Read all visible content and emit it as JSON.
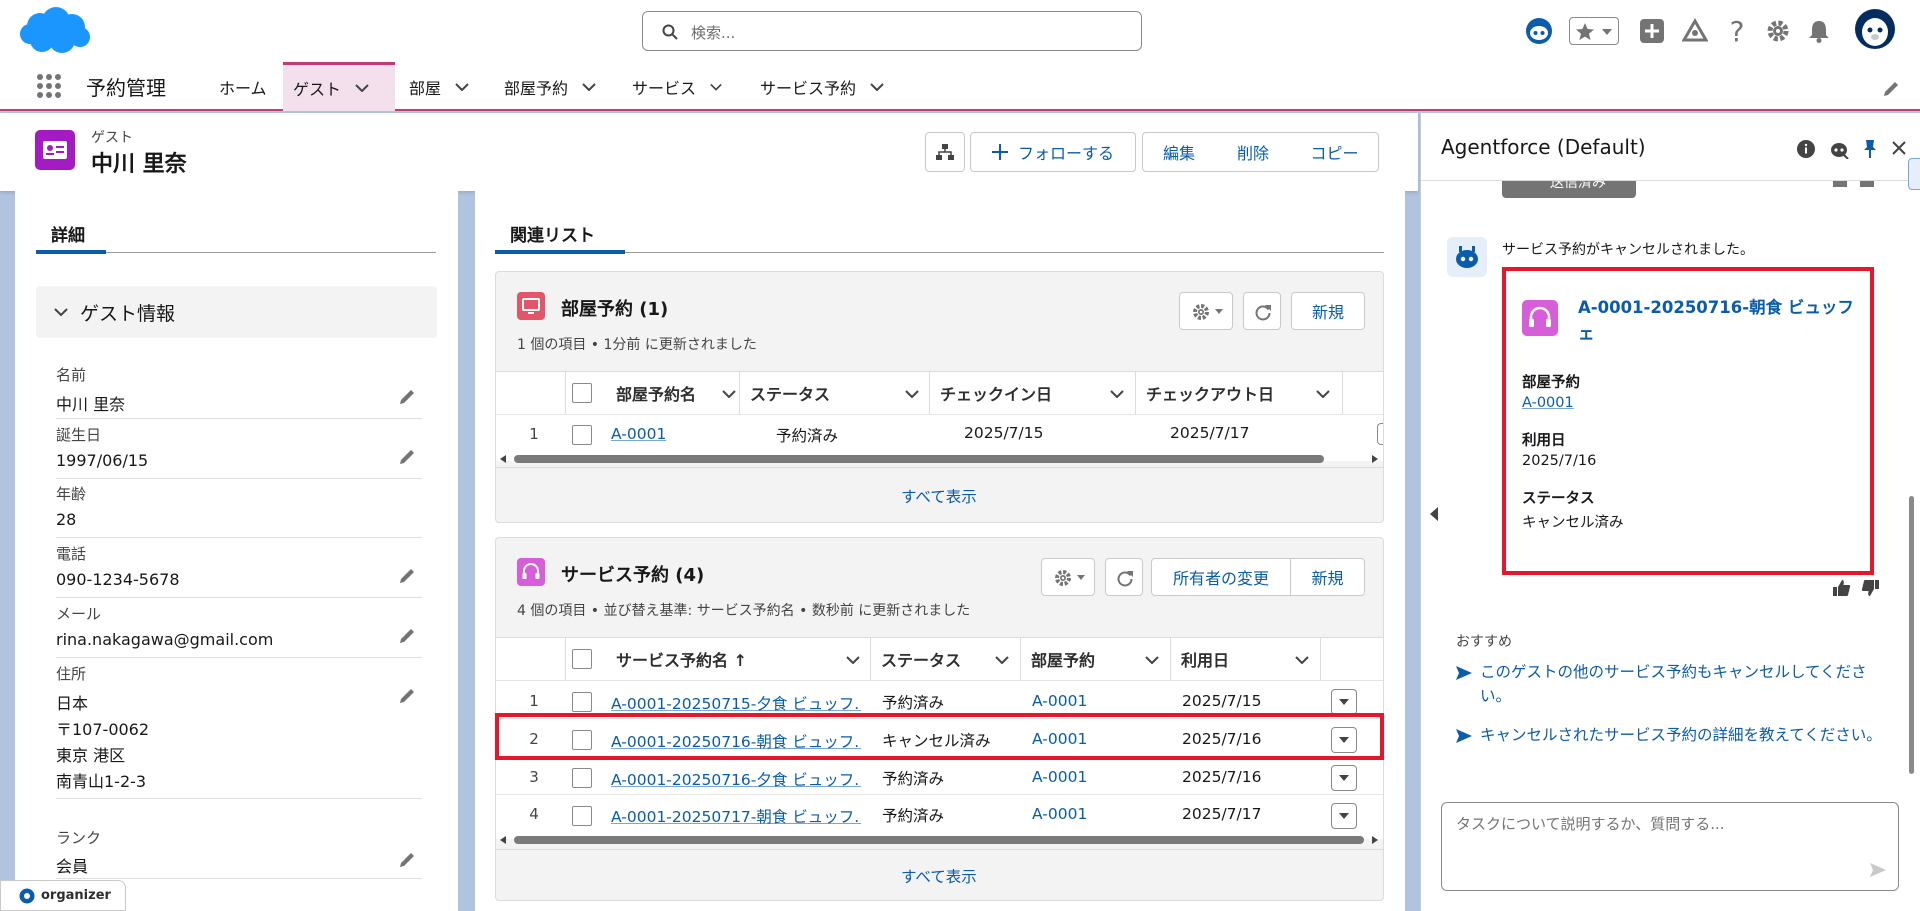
{
  "header": {
    "search_placeholder": "検索...",
    "app_name": "予約管理",
    "nav_tabs": [
      {
        "label": "ホーム"
      },
      {
        "label": "ゲスト"
      },
      {
        "label": "部屋"
      },
      {
        "label": "部屋予約"
      },
      {
        "label": "サービス"
      },
      {
        "label": "サービス予約"
      }
    ]
  },
  "record": {
    "object_label": "ゲスト",
    "name": "中川 里奈",
    "buttons": {
      "follow": "フォローする",
      "edit": "編集",
      "delete": "削除",
      "copy": "コピー"
    }
  },
  "details": {
    "tab": "詳細",
    "section": "ゲスト情報",
    "fields": {
      "name": {
        "label": "名前",
        "value": "中川 里奈"
      },
      "birthday": {
        "label": "誕生日",
        "value": "1997/06/15"
      },
      "age": {
        "label": "年齢",
        "value": "28"
      },
      "phone": {
        "label": "電話",
        "value": "090-1234-5678"
      },
      "email": {
        "label": "メール",
        "value": "rina.nakagawa@gmail.com"
      },
      "address": {
        "label": "住所",
        "lines": [
          "日本",
          "〒107-0062",
          "東京 港区",
          "南青山1-2-3"
        ]
      },
      "rank": {
        "label": "ランク",
        "value": "会員"
      }
    },
    "organizer_badge": "organizer"
  },
  "related": {
    "tab": "関連リスト",
    "room_reservations": {
      "title": "部屋予約 (1)",
      "subtitle": "1 個の項目 • 1分前 に更新されました",
      "new_label": "新規",
      "columns": [
        "部屋予約名",
        "ステータス",
        "チェックイン日",
        "チェックアウト日"
      ],
      "rows": [
        {
          "num": "1",
          "name": "A-0001",
          "status": "予約済み",
          "checkin": "2025/7/15",
          "checkout": "2025/7/17"
        }
      ],
      "view_all": "すべて表示"
    },
    "service_reservations": {
      "title": "サービス予約 (4)",
      "subtitle": "4 個の項目 • 並び替え基準: サービス予約名 • 数秒前 に更新されました",
      "change_owner_label": "所有者の変更",
      "new_label": "新規",
      "columns": [
        "サービス予約名 ↑",
        "ステータス",
        "部屋予約",
        "利用日"
      ],
      "rows": [
        {
          "num": "1",
          "name": "A-0001-20250715-夕食 ビュッフ...",
          "status": "予約済み",
          "room": "A-0001",
          "date": "2025/7/15"
        },
        {
          "num": "2",
          "name": "A-0001-20250716-朝食 ビュッフ...",
          "status": "キャンセル済み",
          "room": "A-0001",
          "date": "2025/7/16"
        },
        {
          "num": "3",
          "name": "A-0001-20250716-夕食 ビュッフ...",
          "status": "予約済み",
          "room": "A-0001",
          "date": "2025/7/16"
        },
        {
          "num": "4",
          "name": "A-0001-20250717-朝食 ビュッフ...",
          "status": "予約済み",
          "room": "A-0001",
          "date": "2025/7/17"
        }
      ],
      "view_all": "すべて表示"
    }
  },
  "agent": {
    "title": "Agentforce (Default)",
    "sent_label": "送信済み",
    "message": "サービス予約がキャンセルされました。",
    "record_card": {
      "title": "A-0001-20250716-朝食 ビュッフェ",
      "fields": [
        {
          "label": "部屋予約",
          "value": "A-0001"
        },
        {
          "label": "利用日",
          "value": "2025/7/16"
        },
        {
          "label": "ステータス",
          "value": "キャンセル済み"
        }
      ]
    },
    "suggestions_label": "おすすめ",
    "suggestions": [
      "このゲストの他のサービス予約もキャンセルしてください。",
      "キャンセルされたサービス予約の詳細を教えてください。"
    ],
    "input_placeholder": "タスクについて説明するか、質問する..."
  },
  "colors": {
    "brand_blue": "#1b96ff",
    "highlight_red": "#e3182c",
    "link": "#0b5cab",
    "nav_accent": "#c23a78"
  }
}
